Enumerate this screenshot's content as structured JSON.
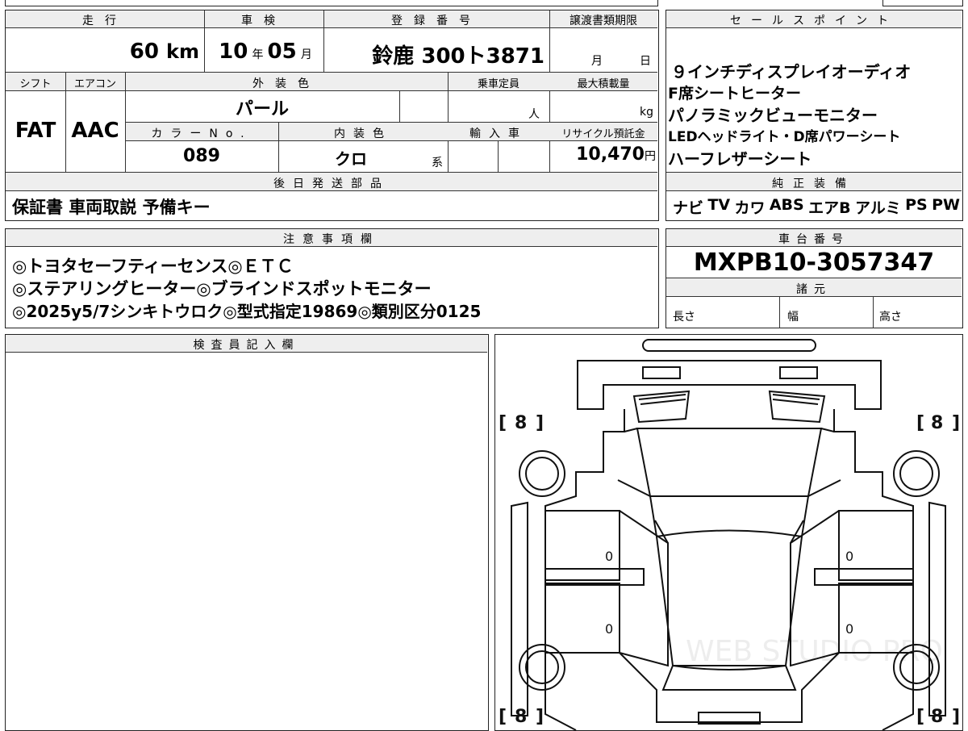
{
  "top": {
    "mileage_label": "走行",
    "mileage_value": "60",
    "mileage_unit": "km",
    "inspection_label": "車検",
    "inspection_year": "10",
    "inspection_year_unit": "年",
    "inspection_month": "05",
    "inspection_month_unit": "月",
    "reg_label": "登録番号",
    "reg_value": "鈴鹿 300ト3871",
    "transfer_label": "譲渡書類期限",
    "transfer_month_unit": "月",
    "transfer_day_unit": "日",
    "shift_label": "シフト",
    "shift_value": "FAT",
    "ac_label": "エアコン",
    "ac_value": "AAC",
    "exterior_label": "外装色",
    "exterior_value": "パール",
    "capacity_label": "乗車定員",
    "capacity_unit": "人",
    "maxload_label": "最大積載量",
    "maxload_unit": "kg",
    "color_no_label": "カラーNo.",
    "color_no_value": "089",
    "interior_label": "内装色",
    "interior_value": "クロ",
    "interior_suffix": "系",
    "import_label": "輸入車",
    "recycle_label": "リサイクル預託金",
    "recycle_value": "10,470",
    "recycle_unit": "円",
    "later_label": "後日発送部品",
    "later_value": "保証書 車両取説 予備キー"
  },
  "sales": {
    "label": "セールスポイント",
    "lines": [
      "９インチディスプレイオーディオ",
      "F席シートヒーター",
      "パノラミックビューモニター",
      "LEDヘッドライト・D席パワーシート",
      "ハーフレザーシート"
    ]
  },
  "genuine": {
    "label": "純正装備",
    "items": [
      "ナビ",
      "TV",
      "カワ",
      "ABS",
      "エアB",
      "アルミ",
      "PS",
      "PW"
    ]
  },
  "notes": {
    "label": "注意事項欄",
    "lines": [
      "◎トヨタセーフティーセンス◎ＥＴＣ",
      "◎ステアリングヒーター◎ブラインドスポットモニター",
      "◎2025y5/7シンキトウロク◎型式指定19869◎類別区分0125"
    ]
  },
  "chassis": {
    "label": "車台番号",
    "value": "MXPB10-3057347",
    "spec_label": "諸元",
    "length_label": "長さ",
    "width_label": "幅",
    "height_label": "高さ"
  },
  "inspector": {
    "label": "検査員記入欄"
  },
  "diagram": {
    "tire_fl": "8",
    "tire_fr": "8",
    "tire_rl": "8",
    "tire_rr": "8",
    "mark_left_front": "0",
    "mark_left_rear": "0",
    "mark_right_front": "0",
    "mark_right_rear": "0",
    "watermark": "WEB STUDIO PRO"
  }
}
